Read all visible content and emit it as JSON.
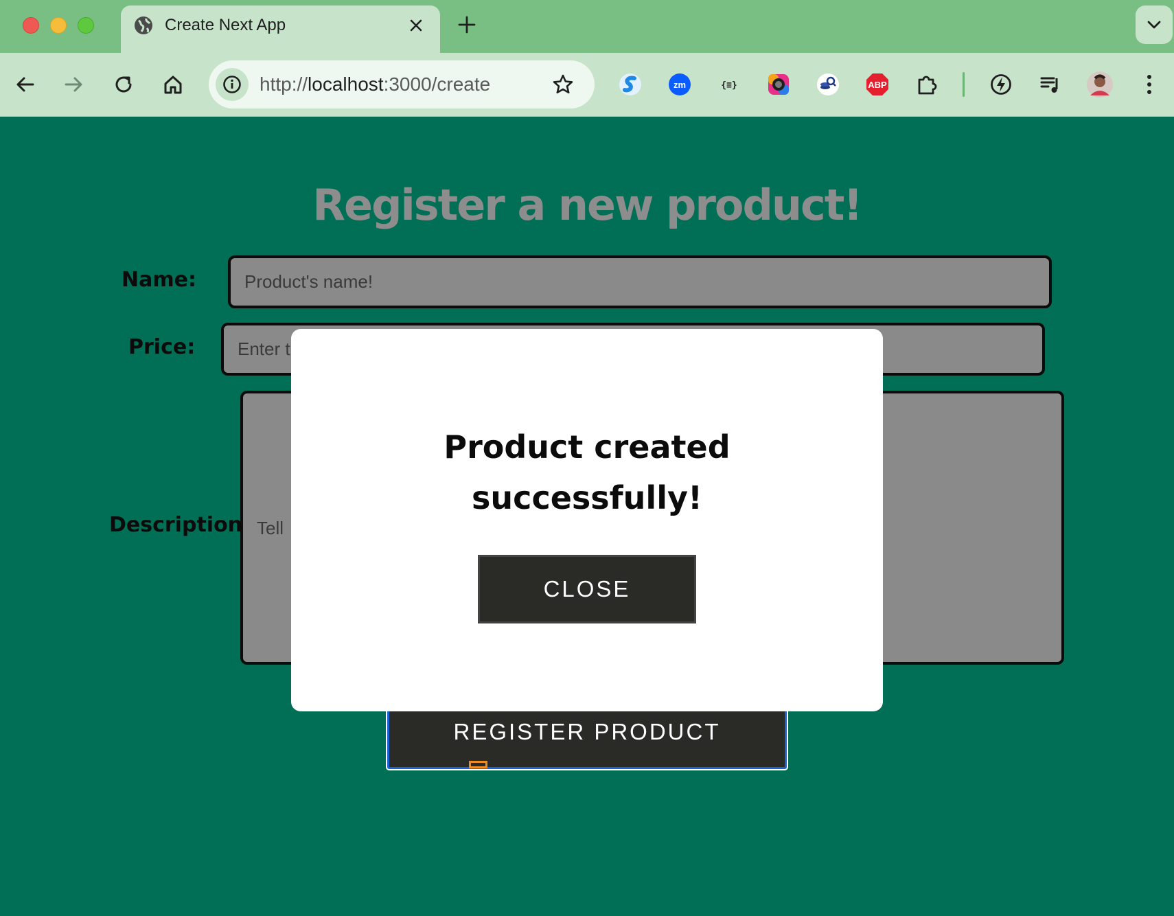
{
  "browser": {
    "tab": {
      "title": "Create Next App",
      "icon": "globe-icon"
    },
    "address_bar": {
      "scheme": "http://",
      "host": "localhost",
      "path": ":3000/create"
    },
    "extensions": [
      {
        "name": "s-logo-extension-icon",
        "color": "#1e88e5"
      },
      {
        "name": "zoom-extension-icon",
        "label": "zm",
        "color": "#0b5cff"
      },
      {
        "name": "json-formatter-extension-icon",
        "label": "{≡}"
      },
      {
        "name": "color-picker-extension-icon"
      },
      {
        "name": "coin-search-extension-icon"
      },
      {
        "name": "adblock-plus-extension-icon",
        "label": "ABP",
        "color": "#e5202e"
      },
      {
        "name": "puzzle-extensions-icon"
      },
      {
        "name": "lightning-extension-icon"
      },
      {
        "name": "media-queue-icon"
      },
      {
        "name": "profile-avatar"
      },
      {
        "name": "more-menu-icon"
      }
    ]
  },
  "page": {
    "title": "Register a new product!",
    "form": {
      "name_label": "Name:",
      "name_placeholder": "Product's name!",
      "price_label": "Price:",
      "price_placeholder_visible": "Enter t",
      "description_label": "Description:",
      "description_placeholder_visible": "Tell",
      "submit_label": "REGISTER PRODUCT"
    }
  },
  "modal": {
    "message": "Product created successfully!",
    "close_label": "CLOSE"
  },
  "colors": {
    "page_background": "#006f55",
    "title_gray": "#8d8d8d",
    "field_gray": "#8a8a8a",
    "button_dark": "#2a2a27",
    "tabstrip_green": "#79bf84",
    "toolbar_green": "#c7e4cb"
  }
}
